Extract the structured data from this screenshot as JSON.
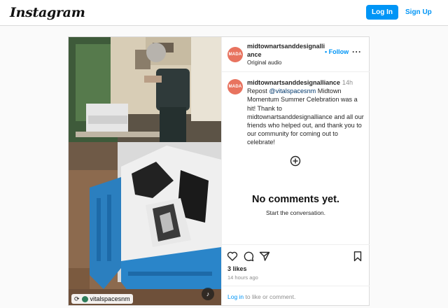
{
  "header": {
    "logo": "Instagram",
    "login_label": "Log In",
    "signup_label": "Sign Up"
  },
  "post": {
    "username": "midtownartsanddesignalliance",
    "avatar_text": "MADA",
    "follow_label": "Follow",
    "audio_label": "Original audio",
    "caption": {
      "username": "midtownartsanddesignalliance",
      "time": "14h",
      "prefix": "Repost",
      "mention": "@vitalspacesnm",
      "text": "Midtown Momentum Summer Celebration was a hit! Thank to midtownartsanddesignalliance and all our friends who helped out, and thank you to our community for coming out to celebrate!"
    },
    "no_comments_title": "No comments yet.",
    "no_comments_sub": "Start the conversation.",
    "likes": "3 likes",
    "timestamp": "14 hours ago",
    "login_prompt": {
      "link": "Log in",
      "text": "to like or comment."
    },
    "media": {
      "repost_handle": "vitalspacesnm"
    }
  },
  "icons": [
    "more-icon",
    "plus-circle-icon",
    "heart-icon",
    "comment-icon",
    "share-icon",
    "bookmark-icon",
    "repost-icon",
    "mute-icon"
  ],
  "colors": {
    "accent": "#0095f6",
    "avatar": "#e8735f",
    "border": "#dbdbdb",
    "muted": "#8e8e8e"
  }
}
